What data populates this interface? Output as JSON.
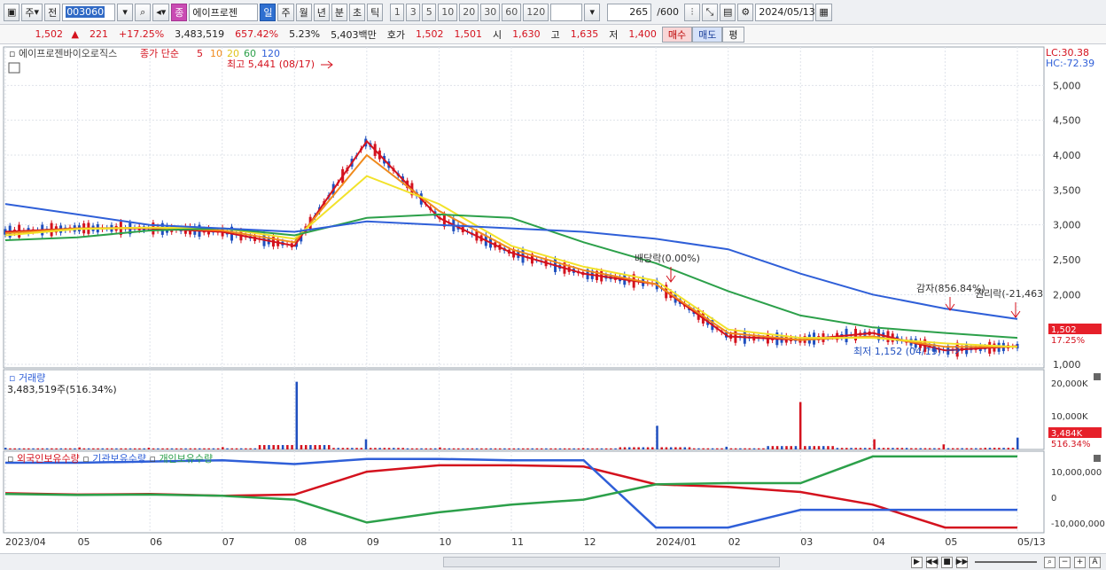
{
  "toolbar": {
    "mode_label": "주",
    "prev_label": "전",
    "code_value": "003060",
    "stock_name_badge": "종",
    "stock_name": "에이프로젠",
    "period_tabs": [
      "일",
      "주",
      "월",
      "년",
      "분",
      "초",
      "틱"
    ],
    "active_period": "일",
    "minute_options": [
      "1",
      "3",
      "5",
      "10",
      "20",
      "30",
      "60",
      "120"
    ],
    "count_value": "265",
    "count_total": "/600",
    "date_value": "2024/05/13"
  },
  "quote": {
    "price": "1,502",
    "change": "221",
    "change_pct": "+17.25%",
    "volume": "3,483,519",
    "volume_pct": "657.42%",
    "turnover": "5.23%",
    "amount": "5,403백만",
    "bid_label": "호가",
    "ask_price": "1,502",
    "bid_price": "1,501",
    "open_label": "시",
    "open": "1,630",
    "high_label": "고",
    "high": "1,635",
    "low_label": "저",
    "low": "1,400",
    "buy_button": "매수",
    "sell_button": "매도",
    "eval_button": "평"
  },
  "legend": {
    "name": "에이프로젠바이오로직스",
    "price_label": "종가 단순",
    "ma": [
      {
        "label": "5",
        "color": "#d4121e"
      },
      {
        "label": "10",
        "color": "#f08a1c"
      },
      {
        "label": "20",
        "color": "#f2e22a"
      },
      {
        "label": "60",
        "color": "#2ca04a"
      },
      {
        "label": "120",
        "color": "#2f5fd8"
      }
    ]
  },
  "right_info": {
    "lc": "LC:30.38",
    "hc": "HC:-72.39"
  },
  "annotations": {
    "high": "최고 5,441 (08/17)",
    "low": "최저 1,152 (04/19)",
    "dividend": "배당락(0.00%)",
    "capital_reduction": "감자(856.84%)",
    "rights": "권리락(-21,463"
  },
  "price_axis": [
    "5,000",
    "4,500",
    "4,000",
    "3,500",
    "3,000",
    "2,500",
    "2,000",
    "1,000"
  ],
  "price_tag": {
    "value": "1,502",
    "pct": "17.25%"
  },
  "volume_panel": {
    "title": "거래량",
    "value": "3,483,519주(516.34%)",
    "axis": [
      "20,000K",
      "10,000K"
    ],
    "tag": {
      "value": "3,484K",
      "pct": "516.34%"
    }
  },
  "holding_panel": {
    "titles": [
      {
        "label": "외국인보유수량",
        "color": "#d4121e"
      },
      {
        "label": "기관보유수량",
        "color": "#2f5fd8"
      },
      {
        "label": "개인보유수량",
        "color": "#2ca04a"
      }
    ],
    "axis": [
      "10,000,000",
      "0",
      "-10,000,000"
    ]
  },
  "x_axis": [
    "2023/04",
    "05",
    "06",
    "07",
    "08",
    "09",
    "10",
    "11",
    "12",
    "2024/01",
    "02",
    "03",
    "04",
    "05",
    "05/13"
  ],
  "colors": {
    "up": "#d4121e",
    "down": "#1f4fbf",
    "grid": "#dfe3ea"
  },
  "chart_data": [
    {
      "type": "line",
      "title": "에이프로젠바이오로직스",
      "x": [
        "2023/04",
        "05",
        "06",
        "07",
        "08",
        "09",
        "10",
        "11",
        "12",
        "2024/01",
        "02",
        "03",
        "04",
        "05",
        "05/13"
      ],
      "series": [
        {
          "name": "5",
          "values": [
            2900,
            2950,
            2950,
            2900,
            2700,
            4200,
            3100,
            2600,
            2300,
            2150,
            1400,
            1350,
            1450,
            1200,
            1260
          ]
        },
        {
          "name": "10",
          "values": [
            2880,
            2950,
            2960,
            2920,
            2750,
            4000,
            3200,
            2650,
            2350,
            2150,
            1450,
            1350,
            1400,
            1250,
            1250
          ]
        },
        {
          "name": "20",
          "values": [
            2850,
            2940,
            2960,
            2950,
            2800,
            3700,
            3300,
            2700,
            2400,
            2200,
            1500,
            1380,
            1380,
            1300,
            1250
          ]
        },
        {
          "name": "60",
          "values": [
            2780,
            2820,
            2920,
            2950,
            2850,
            3100,
            3150,
            3100,
            2750,
            2450,
            2050,
            1700,
            1530,
            1450,
            1380
          ]
        },
        {
          "name": "120",
          "values": [
            3300,
            3150,
            3000,
            2950,
            2900,
            3050,
            3000,
            2950,
            2900,
            2800,
            2650,
            2300,
            2000,
            1800,
            1650
          ]
        }
      ],
      "ylim": [
        1000,
        5500
      ]
    },
    {
      "type": "bar",
      "title": "거래량",
      "x": [
        "2023/04",
        "05",
        "06",
        "07",
        "08",
        "09",
        "10",
        "11",
        "12",
        "2024/01",
        "02",
        "03",
        "04",
        "05",
        "05/13"
      ],
      "series": [
        {
          "name": "거래량",
          "values": [
            500,
            600,
            500,
            700,
            20000,
            3000,
            600,
            500,
            400,
            7000,
            800,
            14000,
            3000,
            1500,
            3484
          ]
        }
      ],
      "ylim": [
        0,
        22000
      ]
    },
    {
      "type": "line",
      "title": "보유수량",
      "x": [
        "2023/04",
        "05",
        "06",
        "07",
        "08",
        "09",
        "10",
        "11",
        "12",
        "2024/01",
        "02",
        "03",
        "04",
        "05",
        "05/13"
      ],
      "series": [
        {
          "name": "외국인보유수량",
          "values": [
            -500000,
            -1000000,
            -800000,
            -1500000,
            -1000000,
            8000000,
            10500000,
            10500000,
            10000000,
            3000000,
            2000000,
            0,
            -5000000,
            -14000000,
            -14000000
          ]
        },
        {
          "name": "기관보유수량",
          "values": [
            11500000,
            11500000,
            12000000,
            12500000,
            11000000,
            13000000,
            13000000,
            12500000,
            12500000,
            -14000000,
            -14000000,
            -7000000,
            -7000000,
            -7000000,
            -7000000
          ]
        },
        {
          "name": "개인보유수량",
          "values": [
            -800000,
            -1200000,
            -1000000,
            -1500000,
            -3000000,
            -12000000,
            -8000000,
            -5000000,
            -3000000,
            3000000,
            3500000,
            3500000,
            14000000,
            14000000,
            14000000
          ]
        }
      ],
      "ylim": [
        -15000000,
        15000000
      ]
    }
  ]
}
